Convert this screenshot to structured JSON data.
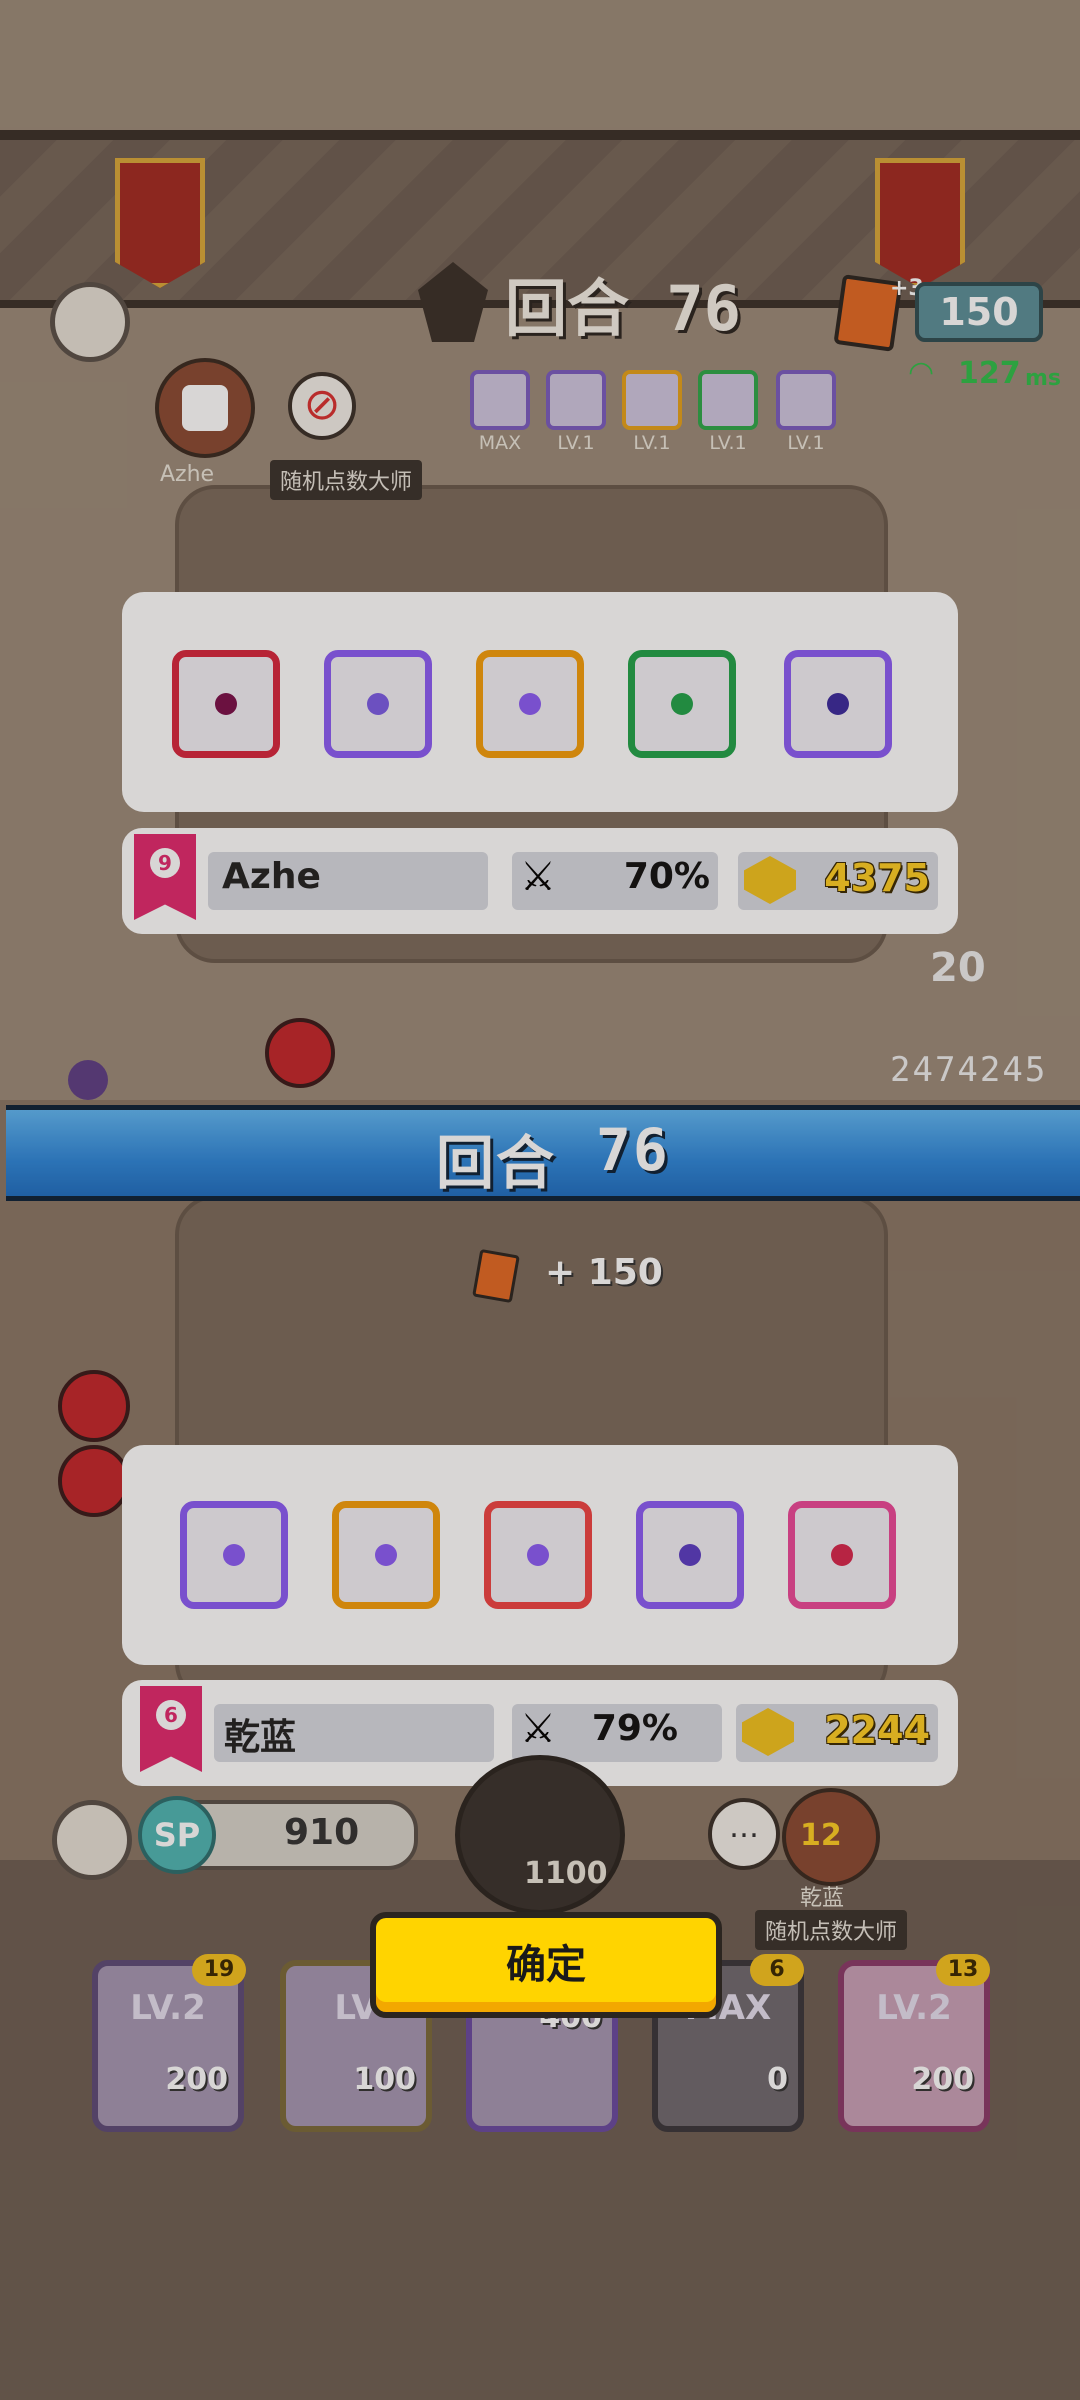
{
  "header": {
    "round_label": "回合 76",
    "card_count": "150",
    "card_bonus": "+3",
    "ping": "127",
    "ping_unit": "ms"
  },
  "opponent": {
    "name": "Azhe",
    "title": "随机点数大师",
    "loadout_levels": [
      "MAX",
      "LV.1",
      "LV.1",
      "LV.1",
      "LV.1"
    ],
    "score": "2474245",
    "wave": "20"
  },
  "top_panel": {
    "dice": [
      {
        "name": "blade-dice",
        "color": "#d7263d"
      },
      {
        "name": "wind-dice",
        "color": "#8b5cf6"
      },
      {
        "name": "infinity-dice",
        "color": "#f59e0b"
      },
      {
        "name": "poison-dice",
        "color": "#22c55e"
      },
      {
        "name": "crack-dice",
        "color": "#8b5cf6"
      }
    ],
    "player": {
      "rank": "9",
      "name": "Azhe",
      "win_rate": "70%",
      "gold": "4375"
    }
  },
  "round_bar": {
    "label": "回合",
    "number": "76"
  },
  "reward": {
    "text": "+ 150"
  },
  "bottom_panel": {
    "dice": [
      {
        "name": "wind-dice",
        "color": "#8b5cf6"
      },
      {
        "name": "infinity-dice",
        "color": "#f59e0b"
      },
      {
        "name": "rainbow-dice",
        "color": "#ef4444"
      },
      {
        "name": "gear-dice",
        "color": "#8b5cf6"
      },
      {
        "name": "sword-dice",
        "color": "#ec4899"
      }
    ],
    "player": {
      "rank": "6",
      "name": "乾蓝",
      "win_rate": "79%",
      "gold": "2244"
    }
  },
  "player_bar": {
    "sp_label": "SP",
    "sp_value": "910",
    "summon_cost": "1100",
    "player_level": "12",
    "player_name": "乾蓝",
    "player_title": "随机点数大师"
  },
  "confirm_label": "确定",
  "deck": [
    {
      "level": "LV.2",
      "count": "19",
      "sp": "200"
    },
    {
      "level": "LV",
      "count": "",
      "sp": "100"
    },
    {
      "level": "",
      "count": "",
      "sp": "400"
    },
    {
      "level": "MAX",
      "count": "6",
      "sp": "0"
    },
    {
      "level": "LV.2",
      "count": "13",
      "sp": "200"
    }
  ]
}
